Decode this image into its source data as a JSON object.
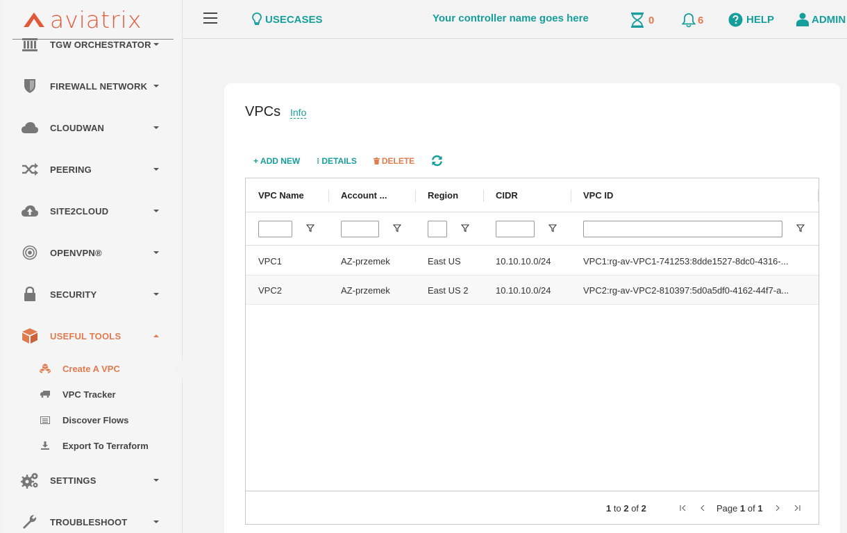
{
  "brand": {
    "logo_text": "aviatrix",
    "color": "#e05a3a"
  },
  "sidebar": {
    "items": [
      {
        "label": "TGW ORCHESTRATOR",
        "icon": "building-icon"
      },
      {
        "label": "FIREWALL NETWORK",
        "icon": "shield-icon"
      },
      {
        "label": "CLOUDWAN",
        "icon": "cloud-icon"
      },
      {
        "label": "PEERING",
        "icon": "shuffle-icon"
      },
      {
        "label": "SITE2CLOUD",
        "icon": "cloud-upload-icon"
      },
      {
        "label": "OPENVPN®",
        "icon": "target-icon"
      },
      {
        "label": "SECURITY",
        "icon": "lock-icon"
      },
      {
        "label": "USEFUL TOOLS",
        "icon": "cube-icon",
        "expanded": true
      },
      {
        "label": "SETTINGS",
        "icon": "gears-icon"
      },
      {
        "label": "TROUBLESHOOT",
        "icon": "wrench-icon"
      }
    ],
    "subitems": [
      {
        "label": "Create A VPC",
        "icon": "cubes-icon",
        "active": true
      },
      {
        "label": "VPC Tracker",
        "icon": "truck-icon"
      },
      {
        "label": "Discover Flows",
        "icon": "list-icon"
      },
      {
        "label": "Export To Terraform",
        "icon": "download-icon"
      }
    ]
  },
  "header": {
    "usecases": "USECASES",
    "controller_name": "Your controller name goes here",
    "tasks_count": "0",
    "notifications_count": "6",
    "help": "HELP",
    "admin": "ADMIN"
  },
  "page": {
    "title": "VPCs",
    "info_link": "Info",
    "toolbar": {
      "add_new": "+ ADD NEW",
      "details": "⁝ DETAILS",
      "delete": "DELETE"
    }
  },
  "grid": {
    "columns": [
      "VPC Name",
      "Account ...",
      "Region",
      "CIDR",
      "VPC ID"
    ],
    "rows": [
      {
        "name": "VPC1",
        "account": "AZ-przemek",
        "region": "East US",
        "cidr": "10.10.10.0/24",
        "vpc_id": "VPC1:rg-av-VPC1-741253:8dde1527-8dc0-4316-..."
      },
      {
        "name": "VPC2",
        "account": "AZ-przemek",
        "region": "East US 2",
        "cidr": "10.10.10.0/24",
        "vpc_id": "VPC2:rg-av-VPC2-810397:5d0a5df0-4162-44f7-a..."
      }
    ],
    "footer": {
      "from": "1",
      "to_word": "to",
      "to": "2",
      "of_word": "of",
      "total": "2",
      "page_word": "Page",
      "page": "1",
      "pages": "1"
    }
  },
  "colors": {
    "accent": "#169e9c",
    "warning": "#e07a4f"
  }
}
